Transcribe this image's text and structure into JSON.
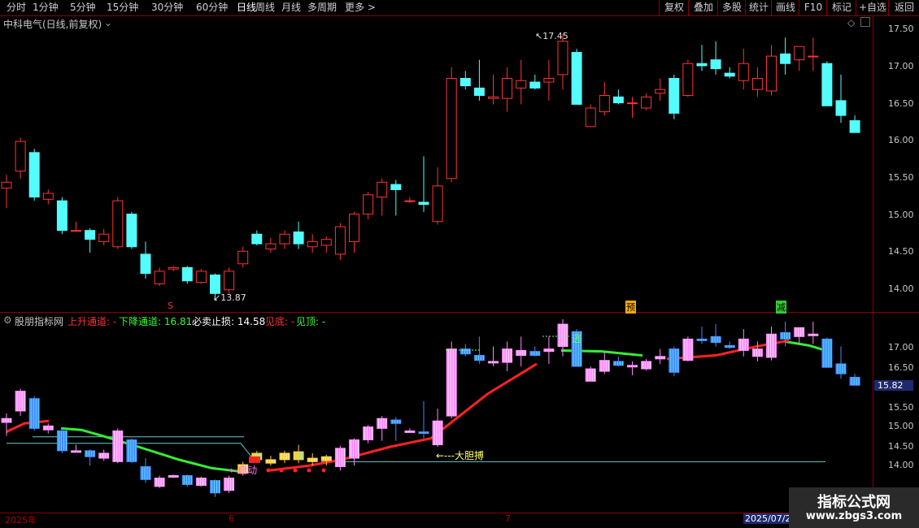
{
  "toolbar": {
    "periods": [
      "分时",
      "1分钟",
      "5分钟",
      "15分钟",
      "30分钟",
      "60分钟",
      "日线",
      "周线",
      "月线",
      "多周期",
      "更多 >"
    ],
    "active": "日线",
    "right_buttons": [
      "复权",
      "叠加",
      "多股",
      "统计",
      "画线",
      "F10",
      "标记",
      "+自选",
      "返回"
    ]
  },
  "main_panel": {
    "title": "中科电气(日线,前复权)",
    "price_labels": [
      "17.50",
      "17.00",
      "16.50",
      "16.00",
      "15.50",
      "15.00",
      "14.50",
      "14.00"
    ],
    "high_annotation": "17.45",
    "low_annotation": "13.87",
    "markers": [
      "S",
      "预",
      "减"
    ]
  },
  "indicator_panel": {
    "name": "股朋指标网",
    "fields": [
      {
        "label": "上升通道:",
        "value": "-",
        "color": "#ff3333"
      },
      {
        "label": "下降通道:",
        "value": "16.81",
        "color": "#33ff33"
      },
      {
        "label": "必卖止损:",
        "value": "14.58",
        "color": "#ffffff"
      },
      {
        "label": "见底:",
        "value": "-",
        "color": "#ff3333"
      },
      {
        "label": "见顶:",
        "value": "-",
        "color": "#33ff33"
      }
    ],
    "price_labels": [
      "17.00",
      "16.50",
      "15.50",
      "15.00",
      "14.50",
      "14.00"
    ],
    "current_price": "15.82",
    "annotations": {
      "start": "启动",
      "bold": "←---大胆搏",
      "escape": "逃"
    }
  },
  "date_axis": {
    "labels": [
      "2025年",
      "6",
      "7",
      "2025/07/2"
    ]
  },
  "watermark": {
    "line1": "指标公式网",
    "line2": "www.zbgs3.com"
  },
  "colors": {
    "up": "#ff3333",
    "down": "#54fcfc",
    "bg": "#000000",
    "grid": "#8b0000"
  },
  "chart_data": {
    "type": "candlestick",
    "candles": [
      [
        15.37,
        15.55,
        15.1,
        15.45
      ],
      [
        15.6,
        16.05,
        15.5,
        16.0
      ],
      [
        15.85,
        15.9,
        15.2,
        15.25
      ],
      [
        15.22,
        15.35,
        15.15,
        15.3
      ],
      [
        15.2,
        15.25,
        14.75,
        14.8
      ],
      [
        14.8,
        14.92,
        14.78,
        14.8
      ],
      [
        14.8,
        14.83,
        14.5,
        14.68
      ],
      [
        14.65,
        14.82,
        14.6,
        14.75
      ],
      [
        14.58,
        15.25,
        14.55,
        15.2
      ],
      [
        15.02,
        15.05,
        14.55,
        14.58
      ],
      [
        14.48,
        14.65,
        14.15,
        14.22
      ],
      [
        14.08,
        14.3,
        14.05,
        14.25
      ],
      [
        14.28,
        14.32,
        14.25,
        14.3
      ],
      [
        14.3,
        14.32,
        14.08,
        14.12
      ],
      [
        14.1,
        14.28,
        14.08,
        14.25
      ],
      [
        14.2,
        14.22,
        13.87,
        13.95
      ],
      [
        14.0,
        14.3,
        13.95,
        14.25
      ],
      [
        14.35,
        14.58,
        14.3,
        14.52
      ],
      [
        14.75,
        14.8,
        14.6,
        14.62
      ],
      [
        14.55,
        14.7,
        14.5,
        14.62
      ],
      [
        14.62,
        14.8,
        14.55,
        14.75
      ],
      [
        14.78,
        14.92,
        14.55,
        14.62
      ],
      [
        14.58,
        14.75,
        14.5,
        14.65
      ],
      [
        14.6,
        14.72,
        14.5,
        14.68
      ],
      [
        14.48,
        14.9,
        14.4,
        14.85
      ],
      [
        14.65,
        15.05,
        14.5,
        15.02
      ],
      [
        15.02,
        15.32,
        14.95,
        15.28
      ],
      [
        15.25,
        15.5,
        15.0,
        15.45
      ],
      [
        15.42,
        15.48,
        15.0,
        15.35
      ],
      [
        15.2,
        15.25,
        15.17,
        15.2
      ],
      [
        15.18,
        15.8,
        15.05,
        15.15
      ],
      [
        14.92,
        15.65,
        14.88,
        15.4
      ],
      [
        15.5,
        17.0,
        15.45,
        16.85
      ],
      [
        16.85,
        16.95,
        16.7,
        16.75
      ],
      [
        16.72,
        17.1,
        16.55,
        16.62
      ],
      [
        16.58,
        16.9,
        16.5,
        16.6
      ],
      [
        16.58,
        17.0,
        16.4,
        16.85
      ],
      [
        16.72,
        17.1,
        16.5,
        16.82
      ],
      [
        16.8,
        16.9,
        16.7,
        16.72
      ],
      [
        16.8,
        17.1,
        16.55,
        16.85
      ],
      [
        16.9,
        17.45,
        16.7,
        17.35
      ],
      [
        17.2,
        17.25,
        16.5,
        16.5
      ],
      [
        16.2,
        16.5,
        16.2,
        16.45
      ],
      [
        16.4,
        16.8,
        16.35,
        16.62
      ],
      [
        16.6,
        16.7,
        16.5,
        16.52
      ],
      [
        16.52,
        16.6,
        16.32,
        16.52
      ],
      [
        16.45,
        16.65,
        16.42,
        16.6
      ],
      [
        16.65,
        16.85,
        16.55,
        16.7
      ],
      [
        16.85,
        16.9,
        16.3,
        16.38
      ],
      [
        16.62,
        17.1,
        16.6,
        17.05
      ],
      [
        17.05,
        17.3,
        16.95,
        17.02
      ],
      [
        17.1,
        17.35,
        16.9,
        16.98
      ],
      [
        16.92,
        17.0,
        16.85,
        16.88
      ],
      [
        16.82,
        17.25,
        16.7,
        17.05
      ],
      [
        16.7,
        17.0,
        16.6,
        16.85
      ],
      [
        16.68,
        17.3,
        16.62,
        17.15
      ],
      [
        17.18,
        17.4,
        16.9,
        17.05
      ],
      [
        17.1,
        17.25,
        16.95,
        17.28
      ],
      [
        17.15,
        17.4,
        16.95,
        17.15
      ],
      [
        17.05,
        17.08,
        16.7,
        16.48
      ],
      [
        16.55,
        16.9,
        16.25,
        16.35
      ],
      [
        16.28,
        16.35,
        16.12,
        16.12
      ]
    ],
    "price_range": [
      13.8,
      17.6
    ],
    "indicator_range": [
      13.8,
      17.4
    ]
  }
}
